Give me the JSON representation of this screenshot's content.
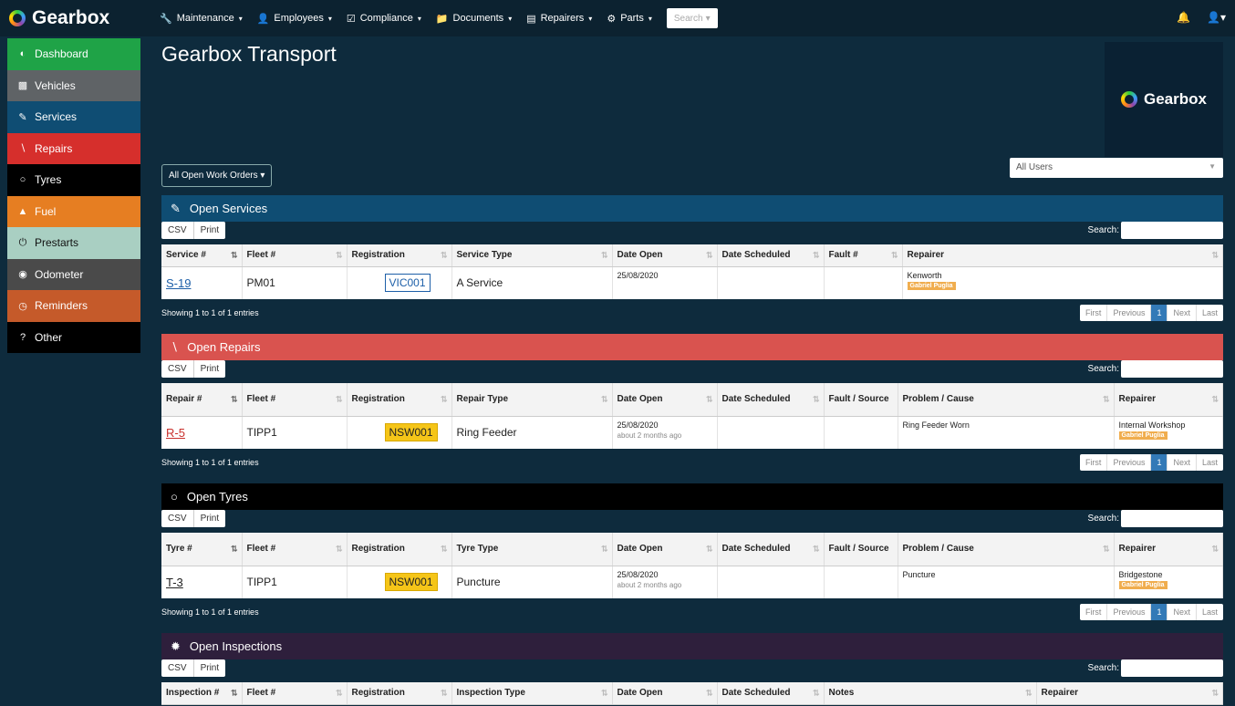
{
  "brand": {
    "name": "Gearbox"
  },
  "topnav": {
    "items": [
      {
        "label": "Maintenance",
        "icon": "wrench-icon"
      },
      {
        "label": "Employees",
        "icon": "user-icon"
      },
      {
        "label": "Compliance",
        "icon": "checkbox-icon"
      },
      {
        "label": "Documents",
        "icon": "folder-icon"
      },
      {
        "label": "Repairers",
        "icon": "list-icon"
      },
      {
        "label": "Parts",
        "icon": "gear-icon"
      }
    ],
    "search_label": "Search"
  },
  "sidebar": {
    "items": [
      {
        "label": "Dashboard",
        "icon": "speedometer-icon"
      },
      {
        "label": "Vehicles",
        "icon": "truck-icon"
      },
      {
        "label": "Services",
        "icon": "wrench-icon"
      },
      {
        "label": "Repairs",
        "icon": "screwdriver-icon"
      },
      {
        "label": "Tyres",
        "icon": "circle-icon"
      },
      {
        "label": "Fuel",
        "icon": "fuel-pump-icon"
      },
      {
        "label": "Prestarts",
        "icon": "power-icon"
      },
      {
        "label": "Odometer",
        "icon": "dashboard-icon"
      },
      {
        "label": "Reminders",
        "icon": "clock-icon"
      },
      {
        "label": "Other",
        "icon": "question-icon"
      }
    ]
  },
  "main": {
    "title": "Gearbox Transport",
    "logo_text": "Gearbox",
    "work_orders_button": "All Open Work Orders",
    "users_select": "All Users"
  },
  "common": {
    "csv": "CSV",
    "print": "Print",
    "search": "Search:",
    "showing": "Showing 1 to 1 of 1 entries",
    "pager": [
      "First",
      "Previous",
      "1",
      "Next",
      "Last"
    ]
  },
  "services": {
    "title": "Open Services",
    "headers": [
      "Service #",
      "Fleet #",
      "Registration",
      "Service Type",
      "Date Open",
      "Date Scheduled",
      "Fault #",
      "Repairer"
    ],
    "row": {
      "id": "S-19",
      "fleet": "PM01",
      "registration": "VIC001",
      "type": "A Service",
      "date_open": "25/08/2020",
      "date_scheduled": "",
      "fault": "",
      "repairer": "Kenworth",
      "person": "Gabriel Puglia"
    }
  },
  "repairs": {
    "title": "Open Repairs",
    "headers": [
      "Repair #",
      "Fleet #",
      "Registration",
      "Repair Type",
      "Date Open",
      "Date Scheduled",
      "Fault / Source",
      "Problem / Cause",
      "Repairer"
    ],
    "row": {
      "id": "R-5",
      "fleet": "TIPP1",
      "registration": "NSW001",
      "type": "Ring Feeder",
      "date_open": "25/08/2020",
      "date_ago": "about 2 months ago",
      "problem": "Ring Feeder Worn",
      "repairer": "Internal Workshop",
      "person": "Gabriel Puglia"
    }
  },
  "tyres": {
    "title": "Open Tyres",
    "headers": [
      "Tyre #",
      "Fleet #",
      "Registration",
      "Tyre Type",
      "Date Open",
      "Date Scheduled",
      "Fault / Source",
      "Problem / Cause",
      "Repairer"
    ],
    "row": {
      "id": "T-3",
      "fleet": "TIPP1",
      "registration": "NSW001",
      "type": "Puncture",
      "date_open": "25/08/2020",
      "date_ago": "about 2 months ago",
      "problem": "Puncture",
      "repairer": "Bridgestone",
      "person": "Gabriel Puglia"
    }
  },
  "inspections": {
    "title": "Open Inspections",
    "headers": [
      "Inspection #",
      "Fleet #",
      "Registration",
      "Inspection Type",
      "Date Open",
      "Date Scheduled",
      "Notes",
      "Repairer"
    ]
  }
}
